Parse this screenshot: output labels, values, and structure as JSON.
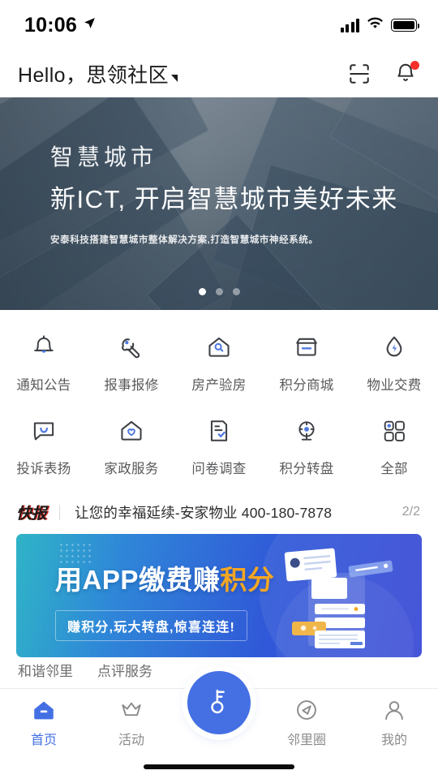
{
  "statusbar": {
    "time": "10:06",
    "location_icon": "location-arrow-icon",
    "signal_icon": "cellular-bars-icon",
    "wifi_icon": "wifi-icon",
    "battery_icon": "battery-full-icon"
  },
  "header": {
    "greeting": "Hello，思领社区",
    "dropdown_icon": "caret-down-icon",
    "scan_icon": "scan-icon",
    "bell_icon": "bell-icon",
    "has_notification": true
  },
  "hero": {
    "title": "智慧城市",
    "subtitle": "新ICT, 开启智慧城市美好未来",
    "description": "安泰科技搭建智慧城市整体解决方案,打造智慧城市神经系统。",
    "dots": 3,
    "active_dot": 0
  },
  "grid": {
    "items": [
      {
        "label": "通知公告",
        "icon": "bell-icon"
      },
      {
        "label": "报事报修",
        "icon": "wrench-icon"
      },
      {
        "label": "房产验房",
        "icon": "house-search-icon"
      },
      {
        "label": "积分商城",
        "icon": "store-icon"
      },
      {
        "label": "物业交费",
        "icon": "water-drop-bolt-icon"
      },
      {
        "label": "投诉表扬",
        "icon": "speech-bubble-smile-icon"
      },
      {
        "label": "家政服务",
        "icon": "house-heart-icon"
      },
      {
        "label": "问卷调查",
        "icon": "document-check-icon"
      },
      {
        "label": "积分转盘",
        "icon": "prize-wheel-icon"
      },
      {
        "label": "全部",
        "icon": "grid-apps-icon"
      }
    ]
  },
  "news": {
    "tag": "快报",
    "text": "让您的幸福延续-安家物业 400-180-7878",
    "counter": "2/2"
  },
  "promo": {
    "headline_a": "用APP缴费赚",
    "headline_b": "积分",
    "subtext": "赚积分,玩大转盘,惊喜连连!",
    "art_icon": "documents-illustration"
  },
  "sections": {
    "left": "和谐邻里",
    "right": "点评服务"
  },
  "tabbar": {
    "items": [
      {
        "label": "首页",
        "icon": "home-icon",
        "active": true
      },
      {
        "label": "活动",
        "icon": "crown-icon",
        "active": false
      },
      {
        "label": "邻里圈",
        "icon": "compass-icon",
        "active": false
      },
      {
        "label": "我的",
        "icon": "person-icon",
        "active": false
      }
    ],
    "center": {
      "icon": "key-icon"
    }
  },
  "colors": {
    "accent": "#4470e4",
    "icon_accent": "#5079e0",
    "badge_red": "#f8302a",
    "promo_highlight": "#f5a623",
    "muted_text": "#8b8b8b"
  }
}
